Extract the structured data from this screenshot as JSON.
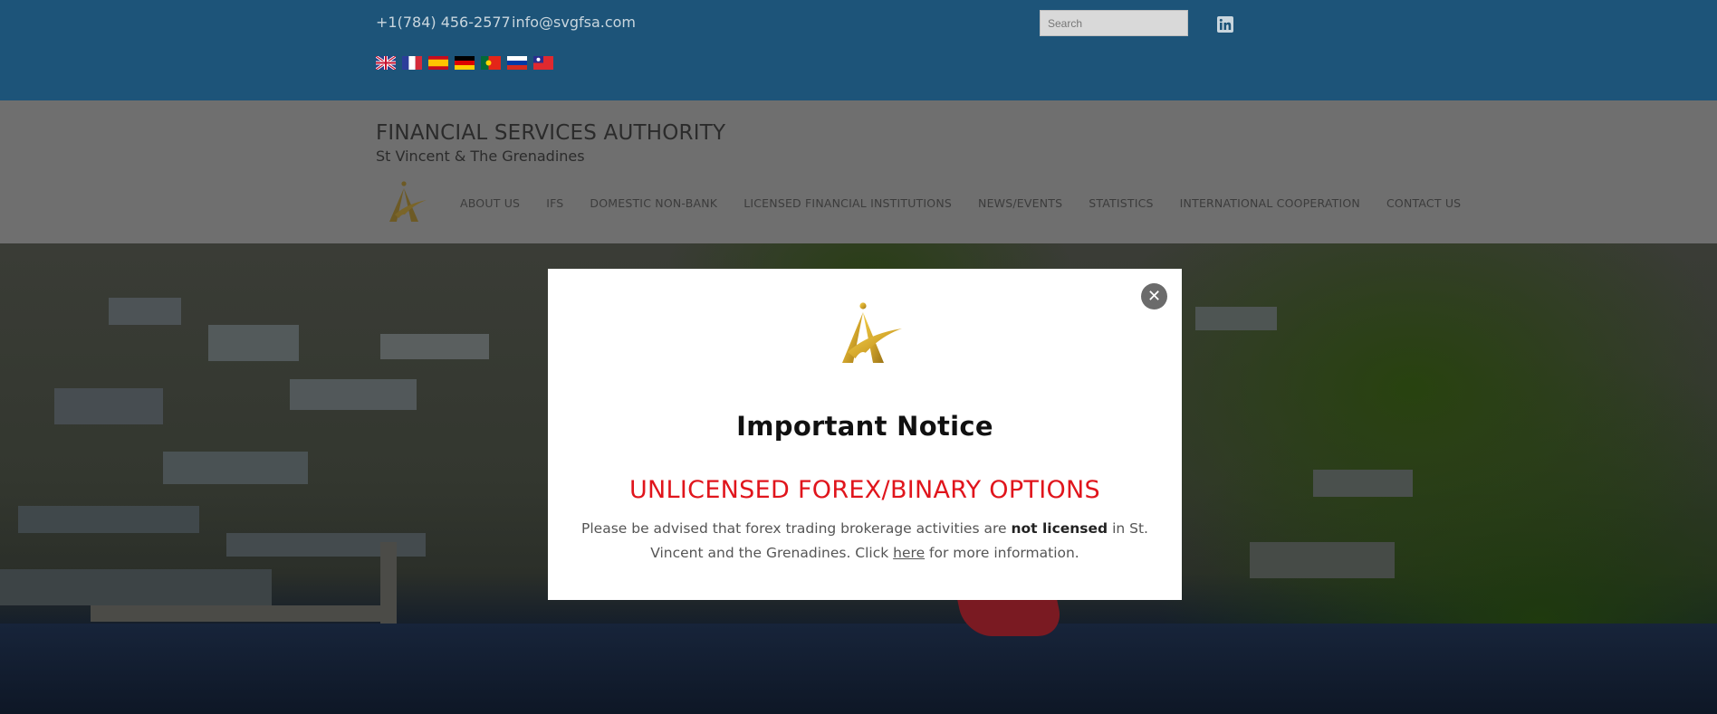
{
  "topbar": {
    "phone": "+1(784) 456-2577",
    "email": "info@svgfsa.com",
    "search_placeholder": "Search",
    "social_icon": "linkedin-icon",
    "languages": [
      "English",
      "French",
      "Spanish",
      "German",
      "Portuguese",
      "Russian",
      "Chinese"
    ]
  },
  "header": {
    "title": "FINANCIAL SERVICES AUTHORITY",
    "subtitle": "St Vincent & The Grenadines",
    "logo_icon": "fsa-logo-icon"
  },
  "nav": {
    "items": [
      "ABOUT US",
      "IFS",
      "DOMESTIC NON-BANK",
      "LICENSED FINANCIAL INSTITUTIONS",
      "NEWS/EVENTS",
      "STATISTICS",
      "INTERNATIONAL COOPERATION",
      "CONTACT US"
    ]
  },
  "modal": {
    "close_label": "✕",
    "heading": "Important Notice",
    "alert": "UNLICENSED FOREX/BINARY OPTIONS",
    "body_pre": "Please be advised that forex trading brokerage activities are ",
    "body_bold": "not licensed",
    "body_mid": " in St. Vincent and the Grenadines. Click ",
    "body_link": "here",
    "body_post": " for more information."
  },
  "colors": {
    "topbar_bg": "#1d5479",
    "header_overlay_bg": "#6f6f6f",
    "alert_red": "#e0151c",
    "logo_gold": "#d4a72c"
  }
}
